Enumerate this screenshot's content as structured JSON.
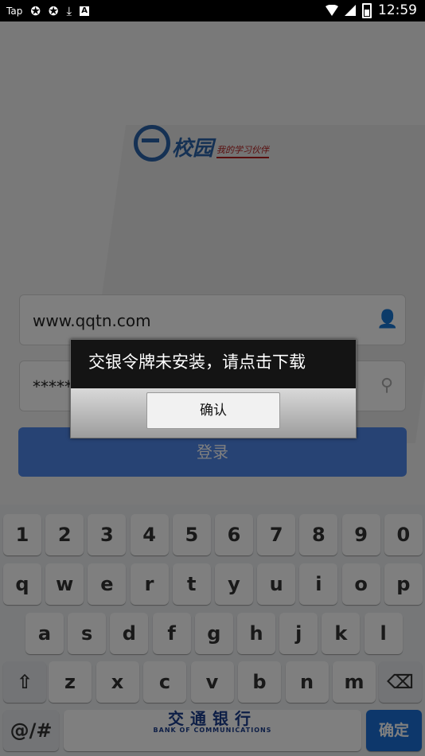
{
  "status_bar": {
    "left_icons": [
      "tap-icon",
      "sync-icon",
      "sync-icon",
      "download-icon",
      "a-icon"
    ],
    "tap_text": "Tap",
    "a_text": "A",
    "time": "12:59"
  },
  "app": {
    "logo": {
      "brand": "校园",
      "slogan": "我的学习伙伴"
    },
    "username_value": "www.qqtn.com",
    "password_value": "*******",
    "login_label": "登录"
  },
  "dialog": {
    "message": "交银令牌未安装，请点击下载",
    "confirm_label": "确认"
  },
  "keyboard": {
    "row_numbers": [
      "1",
      "2",
      "3",
      "4",
      "5",
      "6",
      "7",
      "8",
      "9",
      "0"
    ],
    "row_qwerty": [
      "q",
      "w",
      "e",
      "r",
      "t",
      "y",
      "u",
      "i",
      "o",
      "p"
    ],
    "row_asdf": [
      "a",
      "s",
      "d",
      "f",
      "g",
      "h",
      "j",
      "k",
      "l"
    ],
    "row_zxcv": [
      "z",
      "x",
      "c",
      "v",
      "b",
      "n",
      "m"
    ],
    "sym_label": "@/#",
    "space_cn": "交通银行",
    "space_en": "BANK OF COMMUNICATIONS",
    "done_label": "确定",
    "colors": {
      "done": "#1a6fd6",
      "accent": "#4f86e8"
    }
  }
}
